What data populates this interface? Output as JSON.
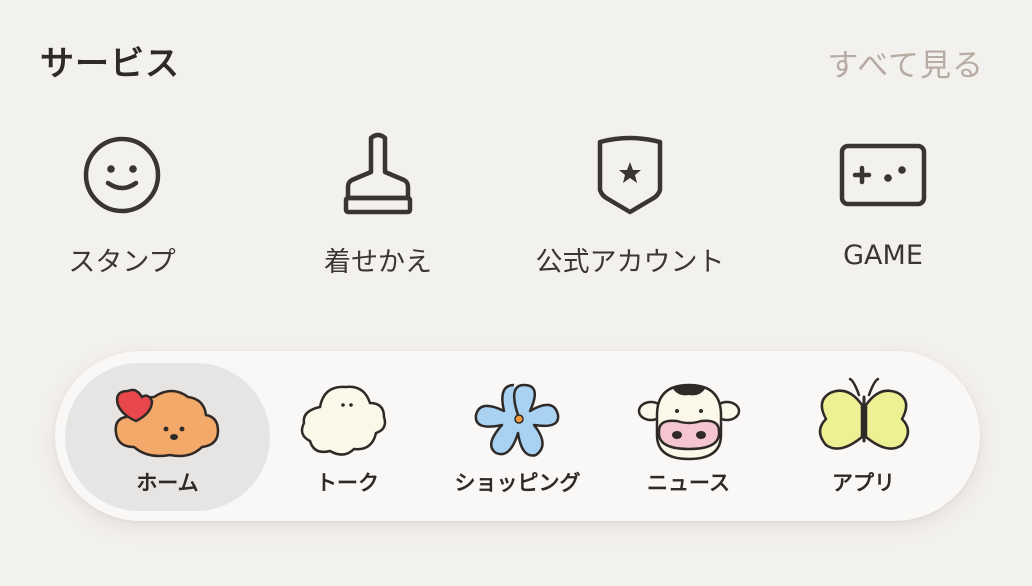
{
  "header": {
    "title": "サービス",
    "see_all": "すべて見る"
  },
  "services": [
    {
      "label": "スタンプ",
      "icon": "smiley-face-icon"
    },
    {
      "label": "着せかえ",
      "icon": "brush-icon"
    },
    {
      "label": "公式アカウント",
      "icon": "shield-star-icon"
    },
    {
      "label": "GAME",
      "icon": "game-controller-icon"
    }
  ],
  "tabbar": {
    "items": [
      {
        "label": "ホーム",
        "icon": "orange-dog-icon",
        "active": true
      },
      {
        "label": "トーク",
        "icon": "white-ghost-icon",
        "active": false
      },
      {
        "label": "ショッピング",
        "icon": "blue-flower-icon",
        "active": false
      },
      {
        "label": "ニュース",
        "icon": "cow-face-icon",
        "active": false
      },
      {
        "label": "アプリ",
        "icon": "yellow-butterfly-icon",
        "active": false
      }
    ]
  },
  "colors": {
    "background": "#f3f1ee",
    "tabbar_background": "#f9f8f6",
    "active_tab": "#e7e5e3",
    "see_all_text": "#b7aba3",
    "icon_stroke": "#3a3532"
  }
}
